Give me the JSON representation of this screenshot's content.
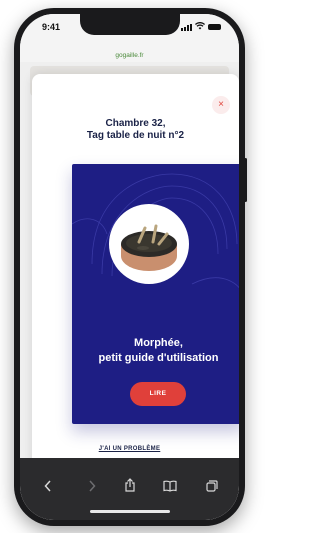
{
  "status_bar": {
    "time": "9:41"
  },
  "browser": {
    "url": "gogaille.fr"
  },
  "modal": {
    "close_symbol": "×",
    "title_line1": "Chambre 32,",
    "title_line2": "Tag table de nuit n°2",
    "card": {
      "heading_line1": "Morphée,",
      "heading_line2": "petit guide d'utilisation",
      "button_label": "LIRE"
    },
    "problem_link": "J'AI UN PROBLÈME"
  },
  "toolbar": {
    "back_icon": "chevron-left-icon",
    "forward_icon": "chevron-right-icon",
    "share_icon": "share-icon",
    "bookmarks_icon": "book-icon",
    "tabs_icon": "tabs-icon"
  },
  "colors": {
    "card_background": "#1e1e84",
    "accent_red": "#e0403a",
    "title_navy": "#1a2247",
    "url_green": "#4a8a3a",
    "toolbar_dark": "#2b2b2d"
  }
}
